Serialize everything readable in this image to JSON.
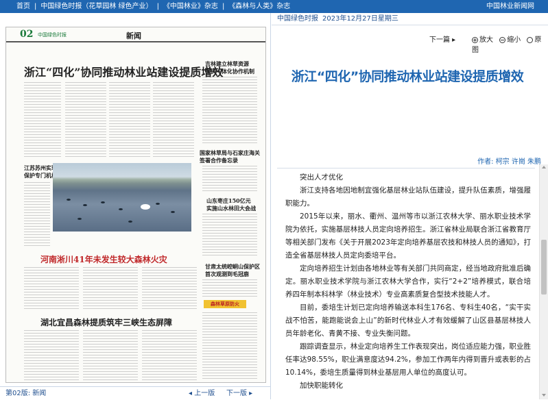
{
  "topbar": {
    "nav": [
      "首页",
      "中国绿色时报（花草园林 绿色产业）",
      "《中国林业》杂志",
      "《森林与人类》杂志"
    ],
    "separator": "|",
    "site_name": "中国林业新闻网"
  },
  "newspaper": {
    "page_number": "02",
    "logo_text": "中国绿色时报",
    "section": "新闻",
    "headlines": {
      "main": "浙江“四化”协同推动林业站建设提质增效",
      "side1": "吉林建立林草资源\n保护一体化协作机制",
      "side2": "江苏苏州实现湿地\n保护专门机构全覆盖",
      "side3": "国家林草局与石家庄海关\n签署合作备忘录",
      "side4": "山东枣庄150亿元\n实施山水林田大会战",
      "side5": "甘肃太统崆峒山保护区\n首次观测到毛冠鹿",
      "fire": "河南淅川41年未发生较大森林火灾",
      "third": "湖北宜昌森林提质筑牢三峡生态屏障",
      "tag": "森林草原防火"
    }
  },
  "left_footer": {
    "edition": "第02版: 新闻",
    "prev_page": "◂ 上一版",
    "next_page": "下一版 ▸"
  },
  "article_header": {
    "paper_name": "中国绿色时报",
    "date": "2023年12月27日星期三"
  },
  "tools": {
    "next_article": "下一篇 ▸",
    "zoom_in": "放大",
    "zoom_out": "缩小",
    "original": "原图"
  },
  "article": {
    "title": "浙江“四化”协同推动林业站建设提质增效",
    "author": "作者: 柯宗  许崗  朱鹏",
    "paragraphs": [
      "突出人才优化",
      "浙江支持各地因地制宜强化基层林业站队伍建设，提升队伍素质，增强履职能力。",
      "2015年以来，丽水、衢州、温州等市以浙江农林大学、丽水职业技术学院为依托，实施基层林技人员定向培养招生。浙江省林业局联合浙江省教育厅等相关部门发布《关于开展2023年定向培养基层农技和林技人员的通知》，打造全省基层林技人员定向委培平台。",
      "定向培养招生计划由各地林业等有关部门共同商定，经当地政府批准后确定。丽水职业技术学院与浙江农林大学合作，实行“2+2”培养模式，联合培养四年制本科林学（林业技术）专业高素质复合型技术技能人才。",
      "目前，委培生计划已定向培养输送本科生176名、专科生40名，“实干实战不怕苦，能跑能说会上山”的新时代林业人才有效缓解了山区县基层林技人员年龄老化、青黄不接、专业失衡问题。",
      "跟踪调查显示，林业定向培养生工作表现突出，岗位适应能力强，职业胜任率达98.55%，职业满意度达94.2%，参加工作两年内得到晋升或表彰的占10.14%，委培生质量得到林业基层用人单位的高度认可。",
      "加快职能转化"
    ]
  },
  "colors": {
    "topbar": "#1f66b1",
    "title": "#1f66b1",
    "headline_red": "#c0282a",
    "tag_yellow": "#f1c232"
  }
}
